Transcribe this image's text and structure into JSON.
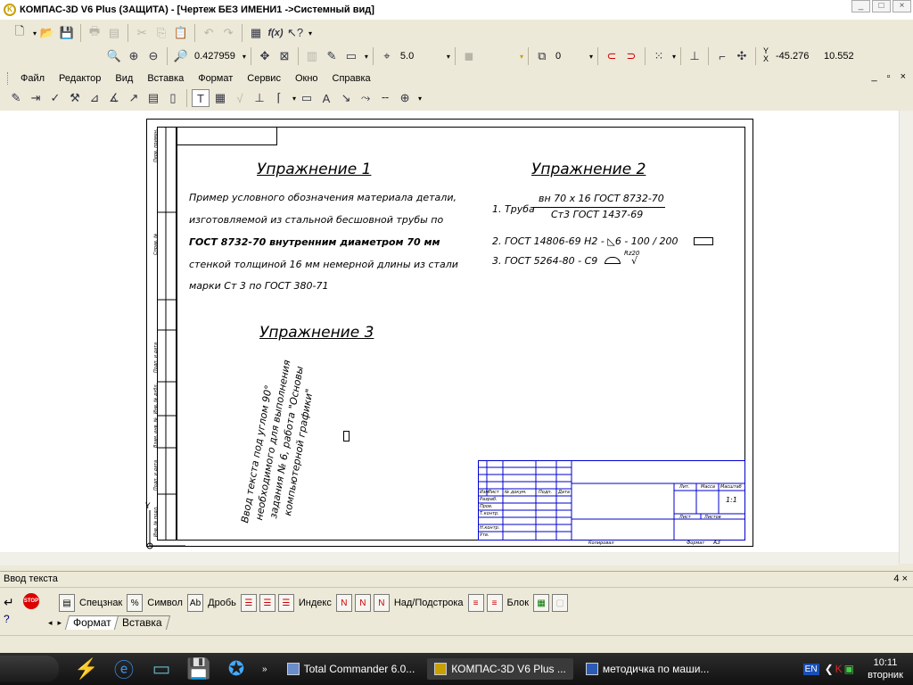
{
  "window": {
    "title": "КОМПАС-3D V6 Plus (ЗАЩИТА) - [Чертеж БЕЗ ИМЕНИ1 ->Системный вид]",
    "app_icon_text": "K"
  },
  "toolbar2": {
    "zoom_value": "0.427959",
    "step_value": "5.0",
    "layer_value": "0",
    "coord_y_label": "Y",
    "coord_x_label": "X",
    "coord_x": "-45.276",
    "coord_y": "10.552"
  },
  "menu": {
    "items": [
      "Файл",
      "Редактор",
      "Вид",
      "Вставка",
      "Формат",
      "Сервис",
      "Окно",
      "Справка"
    ]
  },
  "drawing": {
    "ex1_title": "Упражнение 1",
    "ex1_lines": [
      "Пример условного обозначения материала детали,",
      "изготовляемой из стальной бесшовной трубы по",
      "ГОСТ 8732-70 внутренним диаметром 70 мм",
      "стенкой толщиной 16 мм немерной длины из стали",
      "марки Ст 3 по ГОСТ 380-71"
    ],
    "ex2_title": "Упражнение 2",
    "ex2_item1_prefix": "1. Труба",
    "ex2_item1_num": "вн 70 x 16 ГОСТ 8732-70",
    "ex2_item1_den": "Ст3 ГОСТ 1437-69",
    "ex2_item2": "2. ГОСТ 14806-69 Н2 - ◺6 - 100 / 200",
    "ex2_item3": "3. ГОСТ 5264-80 - С9",
    "ex2_item3_sup": "Rz20",
    "ex3_title": "Упражнение 3",
    "ex3_vertical_lines": [
      "Ввод текста под углом 90°",
      "необходимого для выполнения",
      "задания № 6, работа \"Основы",
      "компьютерной графики\""
    ],
    "sidebar_labels": [
      "Перв. примен.",
      "Справ. №",
      "Подп. и дата",
      "Инв. № дубл.",
      "Взам. инв. №",
      "Подп. и дата",
      "Инв. № подл."
    ],
    "stamp": {
      "izm": "Изм",
      "list": "Лист",
      "ndokum": "№ докум.",
      "podp": "Подп.",
      "data": "Дата",
      "razrab": "Разраб.",
      "prov": "Пров.",
      "tkontr": "Т.контр.",
      "nkontr": "Н.контр.",
      "utv": "Утв.",
      "lit": "Лит.",
      "massa": "Масса",
      "masshtab": "Масштаб",
      "scale_value": "1:1",
      "list2": "Лист",
      "listov": "Листов",
      "kopiroval": "Копировал",
      "format": "Формат",
      "format_value": "A3"
    },
    "axis_y": "Y"
  },
  "text_panel": {
    "title": "Ввод текста",
    "pin": "4 ×",
    "btn_special": "Спецзнак",
    "btn_symbol": "Символ",
    "btn_fraction": "Дробь",
    "btn_index": "Индекс",
    "btn_supsub": "Над/Подстрока",
    "btn_block": "Блок",
    "stop": "STOP",
    "tabs": [
      "Формат",
      "Вставка"
    ]
  },
  "taskbar": {
    "tasks": [
      {
        "label": "Total Commander 6.0..."
      },
      {
        "label": "КОМПАС-3D V6 Plus ..."
      },
      {
        "label": "методичка по маши..."
      }
    ],
    "lang": "EN",
    "time": "10:11",
    "day": "вторник"
  }
}
